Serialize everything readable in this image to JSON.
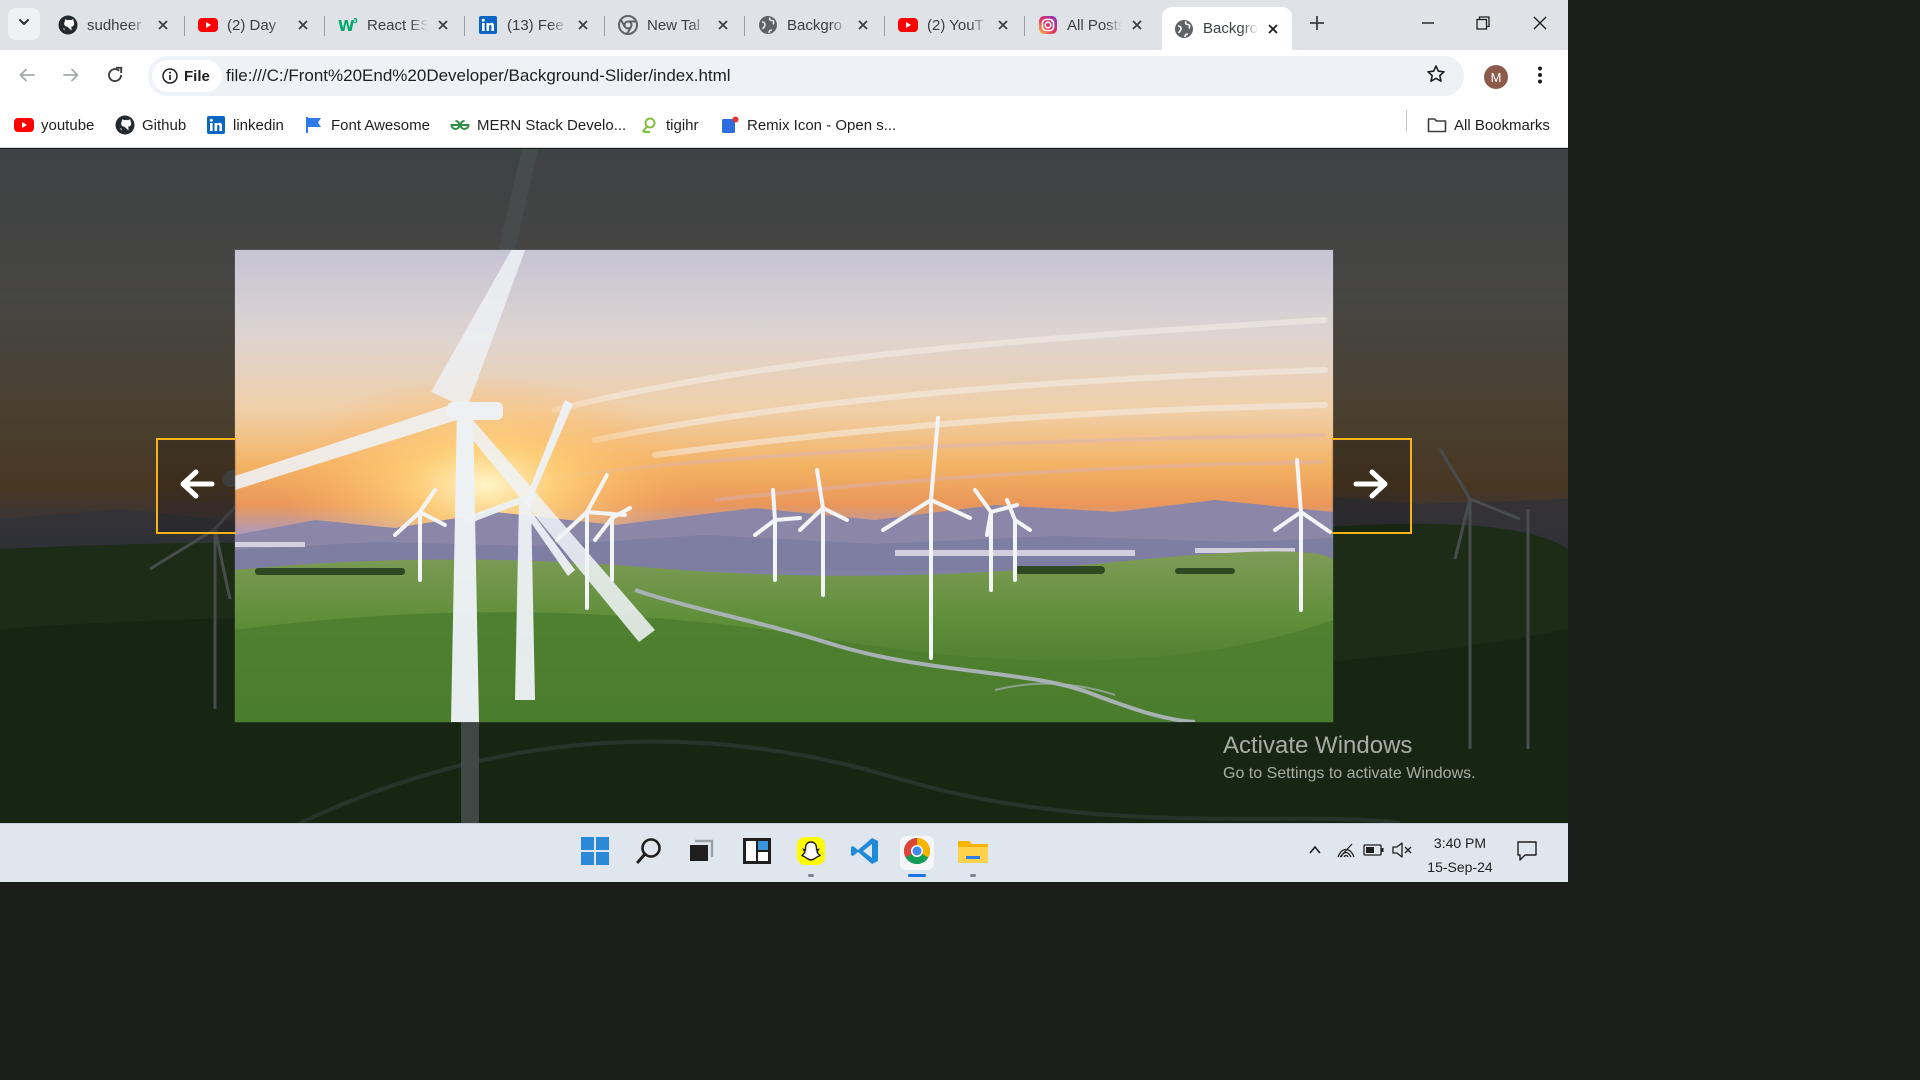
{
  "browser": {
    "tabs": [
      {
        "title": "sudheer",
        "icon": "github-icon"
      },
      {
        "title": "(2) Day",
        "icon": "youtube-icon"
      },
      {
        "title": "React ES",
        "icon": "w3schools-icon"
      },
      {
        "title": "(13) Fee",
        "icon": "linkedin-icon"
      },
      {
        "title": "New Tal",
        "icon": "chrome-icon"
      },
      {
        "title": "Backgro",
        "icon": "globe-icon"
      },
      {
        "title": "(2) YouT",
        "icon": "youtube-icon"
      },
      {
        "title": "All Posts",
        "icon": "instagram-icon"
      },
      {
        "title": "Backgro",
        "icon": "globe-icon",
        "active": true
      }
    ],
    "address": {
      "scheme_chip": "File",
      "url": "file:///C:/Front%20End%20Developer/Background-Slider/index.html"
    },
    "profile_initial": "M",
    "bookmarks": [
      {
        "label": "youtube",
        "icon": "youtube-icon"
      },
      {
        "label": "Github",
        "icon": "github-icon"
      },
      {
        "label": "linkedin",
        "icon": "linkedin-icon"
      },
      {
        "label": "Font Awesome",
        "icon": "flag-icon"
      },
      {
        "label": "MERN Stack Develo...",
        "icon": "geeksforgeeks-icon"
      },
      {
        "label": "tigihr",
        "icon": "tigihr-icon"
      },
      {
        "label": "Remix Icon - Open s...",
        "icon": "remix-icon"
      }
    ],
    "all_bookmarks": "All Bookmarks"
  },
  "page": {
    "arrow_color": "#f5b315",
    "left_arrow": "arrow-left-icon",
    "right_arrow": "arrow-right-icon"
  },
  "windows_notice": {
    "title": "Activate Windows",
    "subtitle": "Go to Settings to activate Windows."
  },
  "taskbar": {
    "time": "3:40 PM",
    "date": "15-Sep-24",
    "apps": [
      "windows-start-icon",
      "search-icon",
      "task-view-icon",
      "widgets-icon",
      "snapchat-icon",
      "vscode-icon",
      "chrome-icon",
      "file-explorer-icon"
    ]
  }
}
